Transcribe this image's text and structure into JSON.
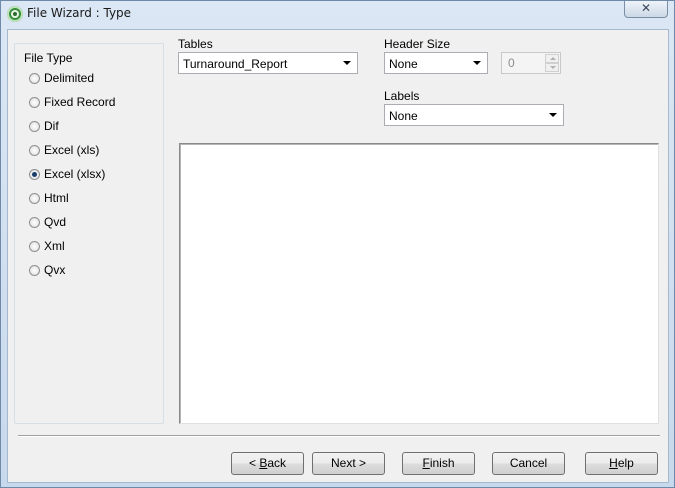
{
  "window": {
    "title": "File Wizard : Type",
    "close_glyph": "✕"
  },
  "file_type": {
    "label": "File Type",
    "options": [
      "Delimited",
      "Fixed Record",
      "Dif",
      "Excel (xls)",
      "Excel (xlsx)",
      "Html",
      "Qvd",
      "Xml",
      "Qvx"
    ],
    "selected": "Excel (xlsx)"
  },
  "tables": {
    "label": "Tables",
    "value": "Turnaround_Report"
  },
  "header_size": {
    "label": "Header Size",
    "value": "None",
    "spin_value": "0"
  },
  "labels": {
    "label": "Labels",
    "value": "None"
  },
  "buttons": {
    "back": {
      "mnemonic": "B",
      "rest": "ack",
      "prefix": "< "
    },
    "next": {
      "label": "Next >"
    },
    "finish": {
      "mnemonic": "F",
      "rest": "inish"
    },
    "cancel": {
      "label": "Cancel"
    },
    "help": {
      "mnemonic": "H",
      "rest": "elp"
    }
  },
  "icons": {
    "app": "qlikview-app-icon",
    "close": "close-icon",
    "dropdown": "chevron-down-icon",
    "spin_up": "spin-up-icon",
    "spin_down": "spin-down-icon"
  }
}
